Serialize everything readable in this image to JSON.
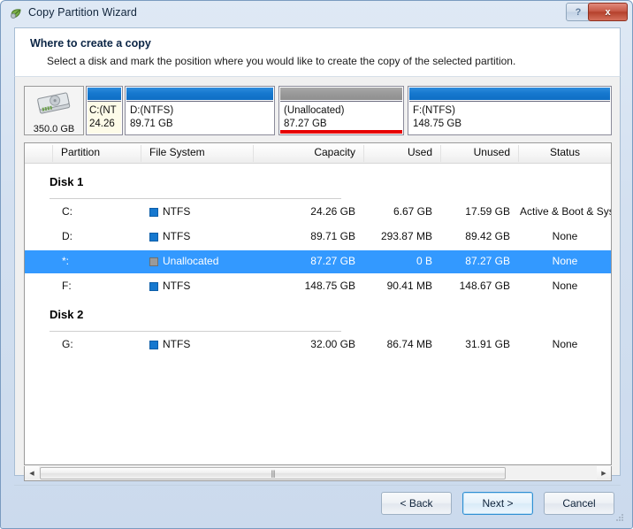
{
  "window": {
    "title": "Copy Partition Wizard",
    "icon": "wizard-leaf-icon",
    "help_label": "?",
    "close_label": "x"
  },
  "header": {
    "title": "Where to create a copy",
    "subtitle": "Select a disk and mark the position where you would like to create the copy of the selected partition."
  },
  "disk_map": {
    "disk_icon": "hard-disk-icon",
    "disk_size": "350.0 GB",
    "partitions": [
      {
        "name": "C:(NT",
        "size": "24.26",
        "bar_color": "#1678cf",
        "kind": "blue",
        "selected": false
      },
      {
        "name": "D:(NTFS)",
        "size": "89.71 GB",
        "bar_color": "#1678cf",
        "kind": "blue",
        "selected": false
      },
      {
        "name": "(Unallocated)",
        "size": "87.27 GB",
        "bar_color": "#9a9a9a",
        "kind": "gray",
        "selected": true
      },
      {
        "name": "F:(NTFS)",
        "size": "148.75 GB",
        "bar_color": "#1678cf",
        "kind": "blue",
        "selected": false
      }
    ],
    "selection_marker_color": "#e60000"
  },
  "table": {
    "columns": [
      "Partition",
      "File System",
      "Capacity",
      "Used",
      "Unused",
      "Status"
    ],
    "groups": [
      {
        "label": "Disk 1",
        "rows": [
          {
            "partition": "C:",
            "file_system": "NTFS",
            "swatch": "blue",
            "capacity": "24.26 GB",
            "used": "6.67 GB",
            "unused": "17.59 GB",
            "status": "Active & Boot & Syste",
            "selected": false
          },
          {
            "partition": "D:",
            "file_system": "NTFS",
            "swatch": "blue",
            "capacity": "89.71 GB",
            "used": "293.87 MB",
            "unused": "89.42 GB",
            "status": "None",
            "selected": false
          },
          {
            "partition": "*:",
            "file_system": "Unallocated",
            "swatch": "gray",
            "capacity": "87.27 GB",
            "used": "0 B",
            "unused": "87.27 GB",
            "status": "None",
            "selected": true
          },
          {
            "partition": "F:",
            "file_system": "NTFS",
            "swatch": "blue",
            "capacity": "148.75 GB",
            "used": "90.41 MB",
            "unused": "148.67 GB",
            "status": "None",
            "selected": false
          }
        ]
      },
      {
        "label": "Disk 2",
        "rows": [
          {
            "partition": "G:",
            "file_system": "NTFS",
            "swatch": "blue",
            "capacity": "32.00 GB",
            "used": "86.74 MB",
            "unused": "31.91 GB",
            "status": "None",
            "selected": false
          }
        ]
      }
    ],
    "selection_color": "#3399ff"
  },
  "scrollbar": {
    "left_arrow": "◀",
    "right_arrow": "▶",
    "grip": "|||"
  },
  "footer": {
    "back_label": "< Back",
    "next_label": "Next >",
    "cancel_label": "Cancel"
  }
}
